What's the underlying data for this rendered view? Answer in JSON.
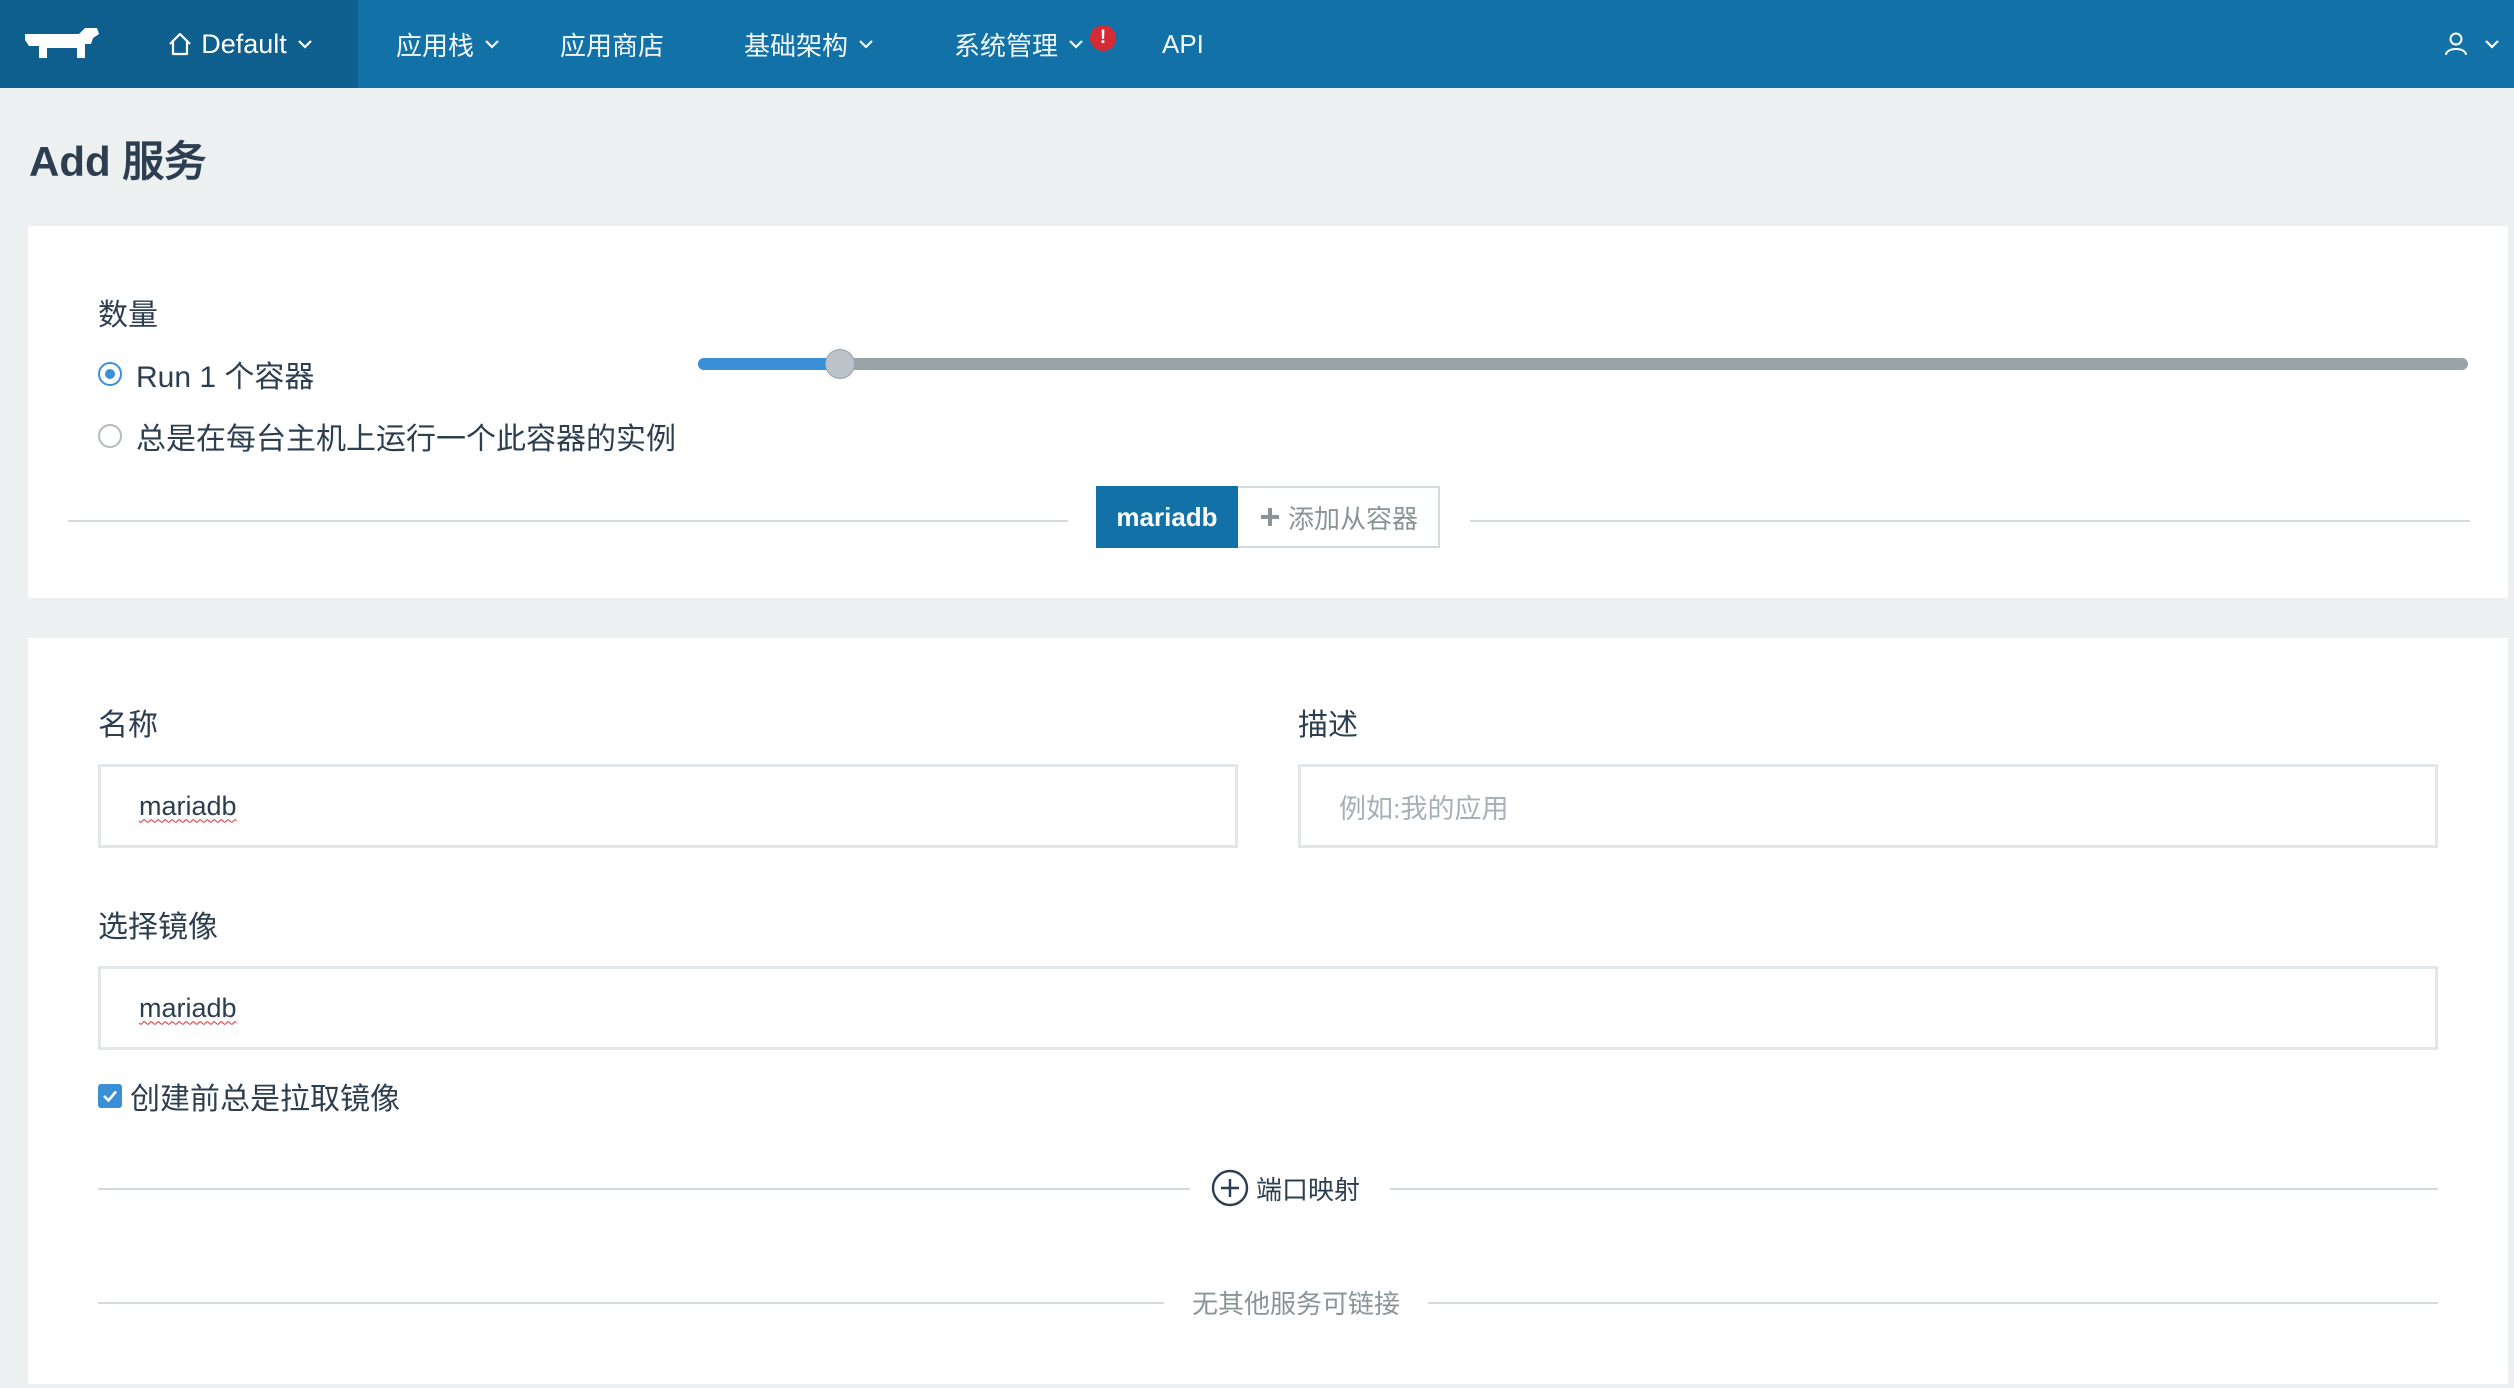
{
  "nav": {
    "environment": "Default",
    "items": [
      {
        "label": "应用栈",
        "dropdown": true
      },
      {
        "label": "应用商店",
        "dropdown": false
      },
      {
        "label": "基础架构",
        "dropdown": true
      },
      {
        "label": "系统管理",
        "dropdown": true,
        "alert": "!"
      },
      {
        "label": "API",
        "dropdown": false
      }
    ]
  },
  "page": {
    "title": "Add 服务"
  },
  "scale": {
    "label": "数量",
    "option_run": "Run 1 个容器",
    "option_global": "总是在每台主机上运行一个此容器的实例",
    "selected": "run",
    "slider_value_fraction": 0.08
  },
  "container_tabs": {
    "active": "mariadb",
    "add_label": "添加从容器"
  },
  "form": {
    "name_label": "名称",
    "name_value": "mariadb",
    "description_label": "描述",
    "description_placeholder": "例如:我的应用",
    "image_label": "选择镜像",
    "image_value": "mariadb",
    "pull_label": "创建前总是拉取镜像",
    "pull_checked": true,
    "port_map_label": "端口映射",
    "no_links_text": "无其他服务可链接"
  },
  "colors": {
    "nav_bg": "#1272a8",
    "nav_active_bg": "#0f5f8e",
    "accent": "#3a8fd6",
    "alert": "#e0282e"
  }
}
